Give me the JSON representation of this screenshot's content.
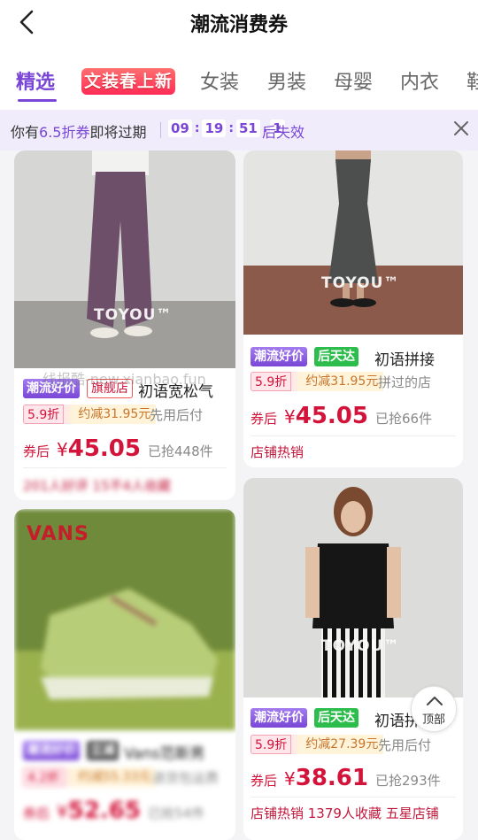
{
  "header": {
    "title": "潮流消费券"
  },
  "tabs": {
    "items": [
      "精选",
      "文装春上新",
      "女装",
      "男装",
      "母婴",
      "内衣",
      "鞋"
    ],
    "active": "精选"
  },
  "notice": {
    "prefix": "你有",
    "highlight": "6.5折券",
    "middle": "即将过期",
    "timer": [
      "09",
      "19",
      "51",
      "1"
    ],
    "suffix": "后失效"
  },
  "watermark": "线报酷-new.xianbao.fun",
  "cards": {
    "left1": {
      "brand_wm": "TOYOU™",
      "badge1": "潮流好价",
      "badge2": "旗舰店",
      "title": "初语宽松气",
      "disc1": "5.9折",
      "disc2": "约减31.95元",
      "muted": "先用后付",
      "coupon": "券后",
      "currency": "¥",
      "price": "45.05",
      "sold": "已抢448件",
      "tags": "201人好评 15不4人收藏"
    },
    "right1": {
      "brand_wm": "TOYOU™",
      "badge1": "潮流好价",
      "badge2": "后天达",
      "title": "初语拼接",
      "disc1": "5.9折",
      "disc2": "约减31.95元",
      "muted": "拼过的店",
      "coupon": "券后",
      "currency": "¥",
      "price": "45.05",
      "sold": "已抢66件",
      "tags": "店铺热销"
    },
    "left2": {
      "brand_wm": "VANS",
      "badge1": "潮流好价",
      "badge2": "立减",
      "title": "Vans范斯男",
      "disc1": "4.2折",
      "disc2": "约减55.33元",
      "muted": "退货包运费",
      "coupon": "券后",
      "currency": "¥",
      "price": "52.65",
      "sold": "已抢54件"
    },
    "right2": {
      "brand_wm": "TOYOU™",
      "badge1": "潮流好价",
      "badge2": "后天达",
      "title": "初语拼",
      "disc1": "5.9折",
      "disc2": "约减27.39元",
      "muted": "先用后付",
      "coupon": "券后",
      "currency": "¥",
      "price": "38.61",
      "sold": "已抢293件",
      "tags": "店铺热销  1379人收藏  五星店铺"
    }
  },
  "top_button": {
    "label": "顶部"
  },
  "colors": {
    "accent": "#7a46d6",
    "price": "#d3133a",
    "notice_bg": "#f1ecfb"
  }
}
